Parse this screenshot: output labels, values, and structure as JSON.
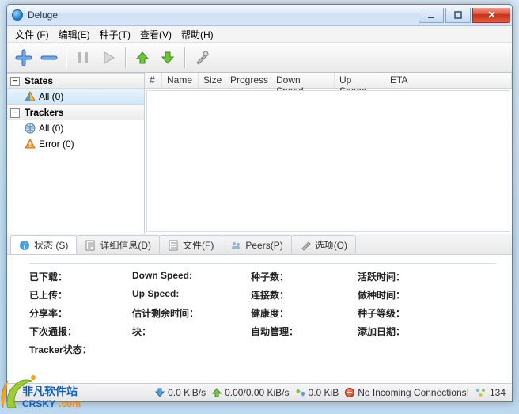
{
  "window": {
    "title": "Deluge"
  },
  "menu": {
    "file": "文件 (F)",
    "edit": "编辑(E)",
    "torrent": "种子(T)",
    "view": "查看(V)",
    "help": "帮助(H)"
  },
  "sidebar": {
    "states_header": "States",
    "states_all": "All (0)",
    "trackers_header": "Trackers",
    "trackers_all": "All (0)",
    "trackers_error": "Error (0)"
  },
  "columns": {
    "num": "#",
    "name": "Name",
    "size": "Size",
    "progress": "Progress",
    "down": "Down Speed",
    "up": "Up Speed",
    "eta": "ETA"
  },
  "tabs": {
    "status": "状态 (S)",
    "details": "详细信息(D)",
    "files": "文件(F)",
    "peers": "Peers(P)",
    "options": "选项(O)"
  },
  "detail_labels": {
    "downloaded": "已下载：",
    "uploaded": "已上传：",
    "ratio": "分享率：",
    "next_announce": "下次通报：",
    "tracker_status": "Tracker状态：",
    "down_speed": "Down Speed:",
    "up_speed": "Up Speed:",
    "eta": "估计剩余时间：",
    "pieces": "块：",
    "seeds": "种子数：",
    "peers": "连接数：",
    "health": "健康度：",
    "auto": "自动管理：",
    "active": "活跃时间：",
    "seeding": "做种时间：",
    "rank": "种子等级：",
    "added": "添加日期："
  },
  "status": {
    "down_rate": "0.0 KiB/s",
    "up_rate": "0.00/0.00 KiB/s",
    "protocol": "0.0 KiB",
    "warning": "No Incoming Connections!",
    "dht": "134"
  },
  "watermark": {
    "line1": "非凡软件站",
    "line2": "CRSKY.com"
  }
}
